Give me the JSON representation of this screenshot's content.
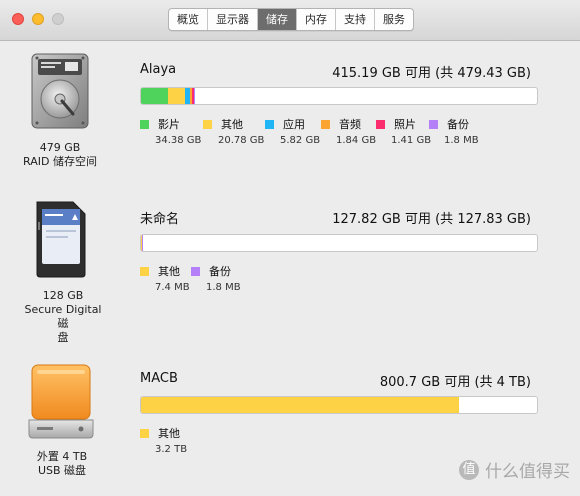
{
  "toolbar": {
    "tabs": [
      "概览",
      "显示器",
      "储存",
      "内存",
      "支持",
      "服务"
    ],
    "active_tab": "储存"
  },
  "colors": {
    "movies": "#4fd35c",
    "other": "#fdd345",
    "apps": "#20b6f5",
    "audio": "#fba431",
    "photos": "#fb2d6e",
    "backups": "#b57ff7",
    "empty": "#ffffff"
  },
  "devices": [
    {
      "icon": "hard-drive-icon",
      "label_line1": "479 GB",
      "label_line2": "RAID 储存空间",
      "name": "Alaya",
      "capacity": "415.19 GB 可用 (共 479.43 GB)",
      "used_fraction": 0.134,
      "legend": [
        {
          "label": "影片",
          "size": "34.38 GB"
        },
        {
          "label": "其他",
          "size": "20.78 GB"
        },
        {
          "label": "应用",
          "size": "5.82 GB"
        },
        {
          "label": "音频",
          "size": "1.84 GB"
        },
        {
          "label": "照片",
          "size": "1.41 GB"
        },
        {
          "label": "备份",
          "size": "1.8 MB"
        }
      ]
    },
    {
      "icon": "sd-card-icon",
      "label_line1": "128 GB",
      "label_line2": "Secure Digital 磁",
      "label_line3": "盘",
      "name": "未命名",
      "capacity": "127.82 GB 可用 (共 127.83 GB)",
      "used_fraction": 0.0001,
      "legend": [
        {
          "label": "其他",
          "size": "7.4 MB"
        },
        {
          "label": "备份",
          "size": "1.8 MB"
        }
      ]
    },
    {
      "icon": "external-drive-icon",
      "label_line1": "外置 4 TB",
      "label_line2": "USB 磁盘",
      "name": "MACB",
      "capacity": "800.7 GB 可用 (共 4 TB)",
      "used_fraction": 0.8,
      "legend": [
        {
          "label": "其他",
          "size": "3.2 TB"
        }
      ]
    }
  ],
  "watermark": {
    "badge": "值",
    "text": "什么值得买"
  }
}
